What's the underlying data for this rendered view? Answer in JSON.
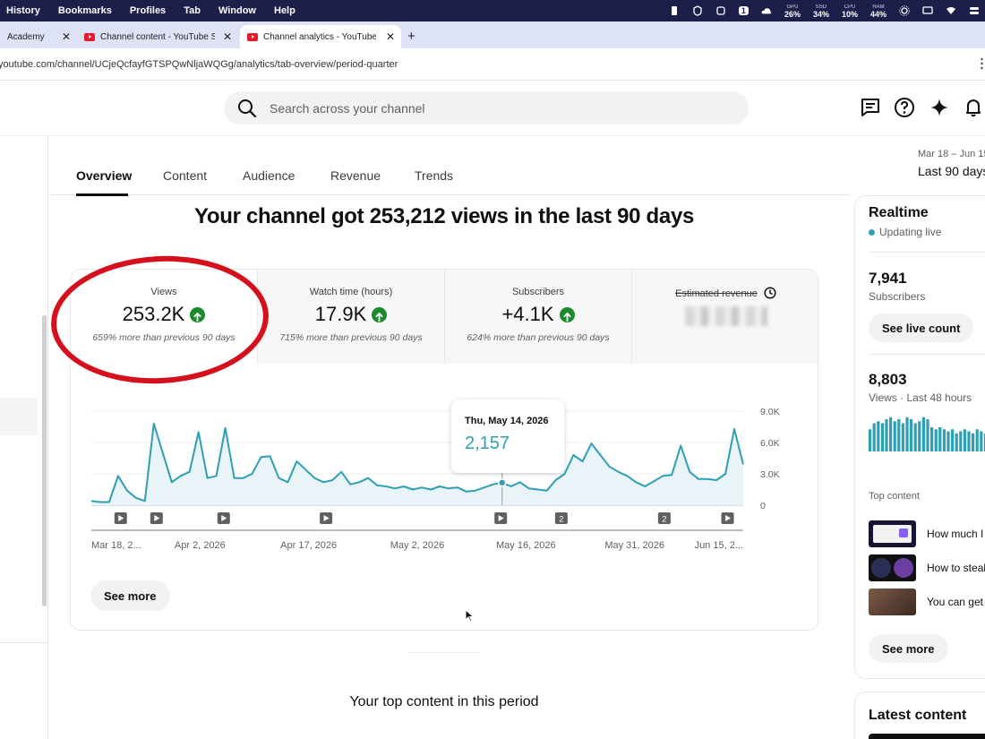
{
  "menubar": {
    "items": [
      "History",
      "Bookmarks",
      "Profiles",
      "Tab",
      "Window",
      "Help"
    ],
    "stats": [
      {
        "label": "GPU",
        "value": "26%"
      },
      {
        "label": "SSD",
        "value": "34%"
      },
      {
        "label": "CPU",
        "value": "10%"
      },
      {
        "label": "RAM",
        "value": "44%"
      }
    ],
    "badge": "1"
  },
  "tabs": [
    {
      "title": "Academy"
    },
    {
      "title": "Channel content - YouTube Studio"
    },
    {
      "title": "Channel analytics - YouTube Studio"
    }
  ],
  "address": "youtube.com/channel/UCjeQcfayfGTSPQwNljaWQGg/analytics/tab-overview/period-quarter",
  "search": {
    "placeholder": "Search across your channel"
  },
  "nav_tabs": [
    "Overview",
    "Content",
    "Audience",
    "Revenue",
    "Trends"
  ],
  "date_range": {
    "range": "Mar 18 – Jun 15",
    "label": "Last 90 days"
  },
  "headline": "Your channel got 253,212 views in the last 90 days",
  "metrics": [
    {
      "label": "Views",
      "value": "253.2K",
      "sub": "659% more than previous 90 days"
    },
    {
      "label": "Watch time (hours)",
      "value": "17.9K",
      "sub": "715% more than previous 90 days"
    },
    {
      "label": "Subscribers",
      "value": "+4.1K",
      "sub": "624% more than previous 90 days"
    },
    {
      "label": "Estimated revenue"
    }
  ],
  "chart_data": {
    "type": "line",
    "x_labels": [
      "Mar 18, 2...",
      "Apr 2, 2026",
      "Apr 17, 2026",
      "May 2, 2026",
      "May 16, 2026",
      "May 31, 2026",
      "Jun 15, 2..."
    ],
    "y_ticks": [
      "9.0K",
      "6.0K",
      "3.0K",
      "0"
    ],
    "ylim": [
      0,
      9000
    ],
    "values": [
      400,
      300,
      300,
      2800,
      1400,
      700,
      400,
      7800,
      5000,
      2200,
      2800,
      3200,
      7000,
      2600,
      2800,
      7400,
      2600,
      2600,
      3000,
      4600,
      4700,
      2600,
      2200,
      4200,
      3400,
      2600,
      2200,
      2400,
      3200,
      2000,
      2200,
      2600,
      1900,
      1800,
      1600,
      1800,
      1500,
      1700,
      1500,
      1800,
      1600,
      1700,
      1300,
      1400,
      1700,
      2000,
      2157,
      1800,
      2200,
      1600,
      1500,
      1400,
      2400,
      3000,
      4800,
      4200,
      5900,
      4800,
      3700,
      3200,
      2800,
      2200,
      1800,
      2300,
      2800,
      2900,
      5700,
      3200,
      2500,
      2500,
      2400,
      3000,
      7300,
      3900
    ],
    "markers": [
      {
        "pos": 0.045,
        "type": "play"
      },
      {
        "pos": 0.1,
        "type": "play"
      },
      {
        "pos": 0.203,
        "type": "play"
      },
      {
        "pos": 0.36,
        "type": "play"
      },
      {
        "pos": 0.628,
        "type": "play"
      },
      {
        "pos": 0.721,
        "type": "count",
        "label": "2"
      },
      {
        "pos": 0.879,
        "type": "count",
        "label": "2"
      },
      {
        "pos": 0.976,
        "type": "play"
      }
    ],
    "highlight_index": 46,
    "tooltip": {
      "date": "Thu, May 14, 2026",
      "value": "2,157"
    },
    "line_color": "#2f9fb3"
  },
  "see_more": "See more",
  "top_content_heading": "Your top content in this period",
  "realtime": {
    "title": "Realtime",
    "status": "Updating live",
    "subscribers": "7,941",
    "subscribers_label": "Subscribers",
    "live_count_button": "See live count",
    "views": "8,803",
    "views_label": "Views · Last 48 hours",
    "bars": [
      0.55,
      0.7,
      0.75,
      0.7,
      0.8,
      0.85,
      0.75,
      0.8,
      0.7,
      0.85,
      0.8,
      0.7,
      0.75,
      0.85,
      0.8,
      0.6,
      0.55,
      0.6,
      0.55,
      0.5,
      0.55,
      0.45,
      0.5,
      0.55,
      0.5,
      0.45,
      0.55,
      0.5,
      0.45,
      0.5,
      0.55
    ],
    "top_content_label": "Top content",
    "videos": [
      {
        "title": "How much I made"
      },
      {
        "title": "How to steal"
      },
      {
        "title": "You can get"
      }
    ],
    "see_more": "See more"
  },
  "latest_content": {
    "title": "Latest content"
  },
  "colors": {
    "accent": "#2f9fb3",
    "up": "#1a8a2b",
    "annotation": "#d5101c"
  }
}
